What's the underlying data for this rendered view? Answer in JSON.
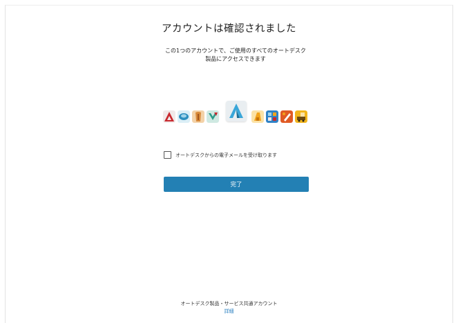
{
  "page": {
    "title": "アカウントは確認されました",
    "subtitle": "この1つのアカウントで、ご使用のすべてのオートデスク製品にアクセスできます"
  },
  "products": {
    "icons": [
      {
        "name": "autocad-icon",
        "color": "#c8282e"
      },
      {
        "name": "civil-3d-icon",
        "color": "#2d8fbf"
      },
      {
        "name": "inventor-icon",
        "color": "#d88a3a"
      },
      {
        "name": "maya-icon",
        "color": "#2d9c8a"
      },
      {
        "name": "autodesk-logo-icon",
        "color": "#3aa6d8"
      },
      {
        "name": "fusion-icon",
        "color": "#f2a31c"
      },
      {
        "name": "revit-icon",
        "color": "#2f82c6"
      },
      {
        "name": "sketchbook-icon",
        "color": "#e05a24"
      },
      {
        "name": "construction-icon",
        "color": "#f1b51c"
      }
    ]
  },
  "consent": {
    "label": "オートデスクからの電子メールを受け取ります",
    "checked": false
  },
  "actions": {
    "done_label": "完了",
    "accent": "#2380b4"
  },
  "footer": {
    "text": "オートデスク製品・サービス共通アカウント",
    "link": "詳細",
    "link_color": "#2a7fc0"
  }
}
